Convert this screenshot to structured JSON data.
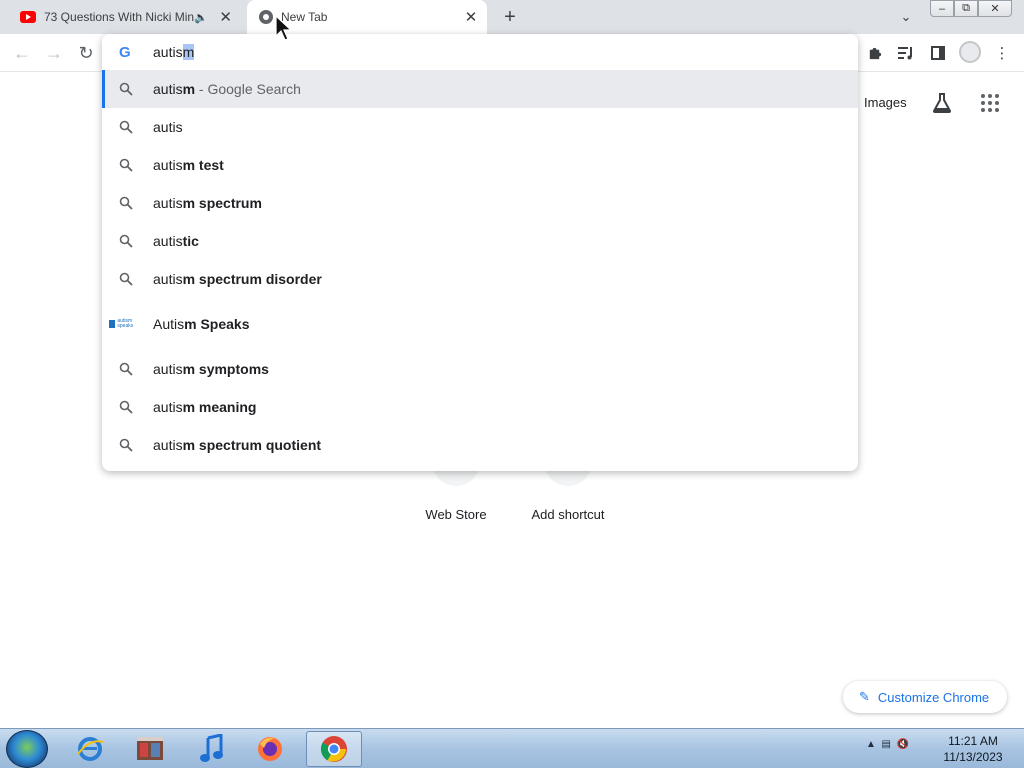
{
  "browser": {
    "tabs": [
      {
        "title": "73 Questions With Nicki Min",
        "favicon": "youtube-icon",
        "audio": true
      },
      {
        "title": "New Tab",
        "favicon": "chrome-icon",
        "active": true
      }
    ]
  },
  "omnibox": {
    "typed": "autis",
    "autocomplete": "m",
    "suggestions": [
      {
        "prefix": "autis",
        "match": "m",
        "suffix": " - Google Search",
        "icon": "search-icon"
      },
      {
        "prefix": "autis",
        "match": "",
        "suffix": "",
        "icon": "search-icon"
      },
      {
        "prefix": "autis",
        "match": "m test",
        "suffix": "",
        "icon": "search-icon"
      },
      {
        "prefix": "autis",
        "match": "m spectrum",
        "suffix": "",
        "icon": "search-icon"
      },
      {
        "prefix": "autis",
        "match": "tic",
        "suffix": "",
        "icon": "search-icon"
      },
      {
        "prefix": "autis",
        "match": "m spectrum disorder",
        "suffix": "",
        "icon": "search-icon"
      },
      {
        "prefix": "Autis",
        "match": "m Speaks",
        "suffix": "",
        "icon": "autism-speaks-logo"
      },
      {
        "prefix": "autis",
        "match": "m symptoms",
        "suffix": "",
        "icon": "search-icon"
      },
      {
        "prefix": "autis",
        "match": "m meaning",
        "suffix": "",
        "icon": "search-icon"
      },
      {
        "prefix": "autis",
        "match": "m spectrum quotient",
        "suffix": "",
        "icon": "search-icon"
      }
    ]
  },
  "autism_speaks_logo_text": "autism speaks",
  "page": {
    "images_link": "Images",
    "shortcuts": [
      {
        "label": "Web Store"
      },
      {
        "label": "Add shortcut"
      }
    ],
    "customize_label": "Customize Chrome"
  },
  "taskbar": {
    "time": "11:21 AM",
    "date": "11/13/2023"
  },
  "colors": {
    "accent": "#1a73e8",
    "selection": "#a9c5f5",
    "tabstrip": "#dee1e6"
  }
}
